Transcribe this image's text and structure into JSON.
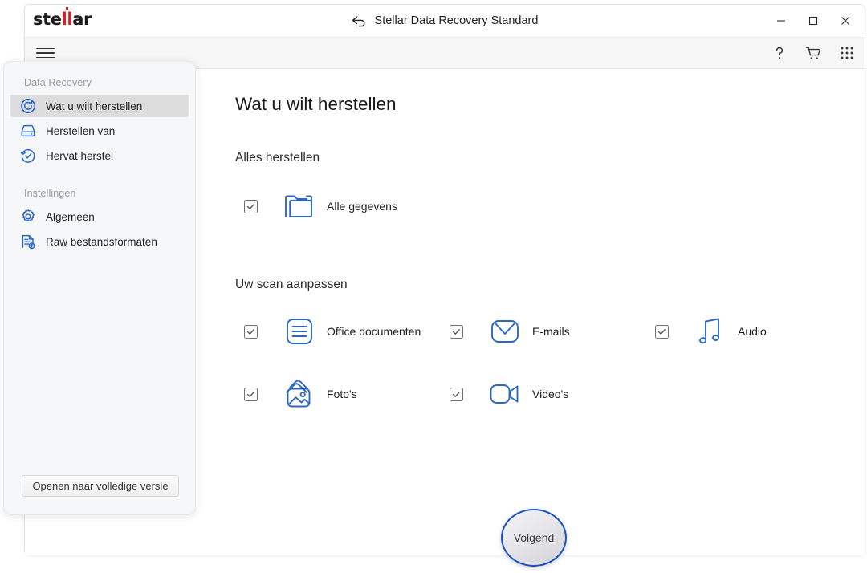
{
  "window": {
    "brand": {
      "pre": "ste",
      "mid": "ll",
      "post": "ar"
    },
    "title": "Stellar Data Recovery Standard",
    "back_icon": "back-arrow-icon",
    "controls": {
      "minimize": "–",
      "maximize": "☐",
      "close": "✕"
    }
  },
  "toolbar": {
    "menu_icon": "hamburger-icon",
    "help_icon": "question-mark-icon",
    "cart_icon": "shopping-cart-icon",
    "apps_icon": "apps-grid-icon"
  },
  "sidebar": {
    "sections": [
      {
        "title": "Data Recovery",
        "items": [
          {
            "label": "Wat u wilt herstellen",
            "icon": "refresh-circle-icon",
            "selected": true
          },
          {
            "label": "Herstellen van",
            "icon": "hard-drive-icon",
            "selected": false
          },
          {
            "label": "Hervat herstel",
            "icon": "resume-check-icon",
            "selected": false
          }
        ]
      },
      {
        "title": "Instellingen",
        "items": [
          {
            "label": "Algemeen",
            "icon": "gear-icon",
            "selected": false
          },
          {
            "label": "Raw bestandsformaten",
            "icon": "raw-file-icon",
            "selected": false
          }
        ]
      }
    ],
    "upgrade_label": "Openen naar volledige versie"
  },
  "content": {
    "page_title": "Wat u wilt herstellen",
    "sections": [
      {
        "heading": "Alles herstellen",
        "options": [
          {
            "label": "Alle gegevens",
            "icon": "folder-icon",
            "checked": true
          }
        ]
      },
      {
        "heading": "Uw scan aanpassen",
        "options": [
          {
            "label": "Office documenten",
            "icon": "document-lines-icon",
            "checked": true
          },
          {
            "label": "E-mails",
            "icon": "envelope-icon",
            "checked": true
          },
          {
            "label": "Audio",
            "icon": "music-note-icon",
            "checked": true
          },
          {
            "label": "Foto's",
            "icon": "photo-stack-icon",
            "checked": true
          },
          {
            "label": "Video's",
            "icon": "video-camera-icon",
            "checked": true
          }
        ]
      }
    ]
  },
  "footer": {
    "next_label": "Volgend"
  },
  "colors": {
    "accent_blue": "#2b68c4",
    "brand_red": "#d81f26",
    "button_ring": "#1a51c4",
    "sidebar_bg": "#f6f7f9",
    "selected_item_bg": "#dddddd"
  }
}
